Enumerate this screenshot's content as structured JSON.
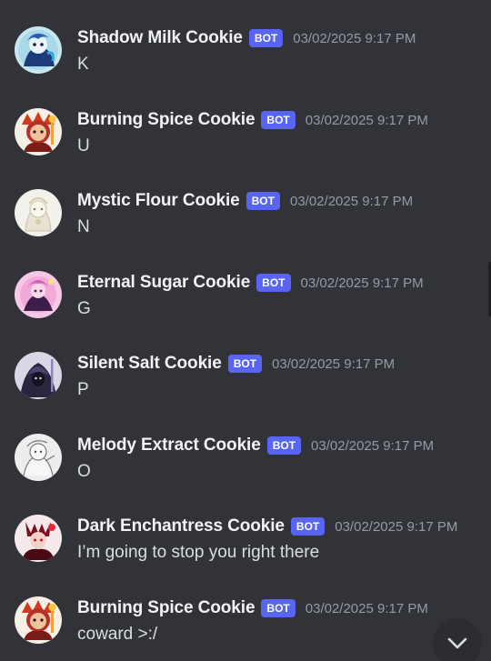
{
  "bot_tag": "BOT",
  "colors": {
    "background": "#313338",
    "username": "#f2f3f5",
    "text": "#dbdee1",
    "timestamp": "#949ba4",
    "bot_tag": "#5865f2"
  },
  "messages": [
    {
      "author": "Shadow Milk Cookie",
      "timestamp": "03/02/2025 9:17 PM",
      "text": "K"
    },
    {
      "author": "Burning Spice Cookie",
      "timestamp": "03/02/2025 9:17 PM",
      "text": "U"
    },
    {
      "author": "Mystic Flour Cookie",
      "timestamp": "03/02/2025 9:17 PM",
      "text": "N"
    },
    {
      "author": "Eternal Sugar Cookie",
      "timestamp": "03/02/2025 9:17 PM",
      "text": "G"
    },
    {
      "author": "Silent Salt Cookie",
      "timestamp": "03/02/2025 9:17 PM",
      "text": "P"
    },
    {
      "author": "Melody Extract Cookie",
      "timestamp": "03/02/2025 9:17 PM",
      "text": "O"
    },
    {
      "author": "Dark Enchantress Cookie",
      "timestamp": "03/02/2025 9:17 PM",
      "text": "I’m going to stop you right there"
    },
    {
      "author": "Burning Spice Cookie",
      "timestamp": "03/02/2025 9:17 PM",
      "text": "coward >:/"
    }
  ],
  "jump_button_icon": "chevron-down-icon"
}
